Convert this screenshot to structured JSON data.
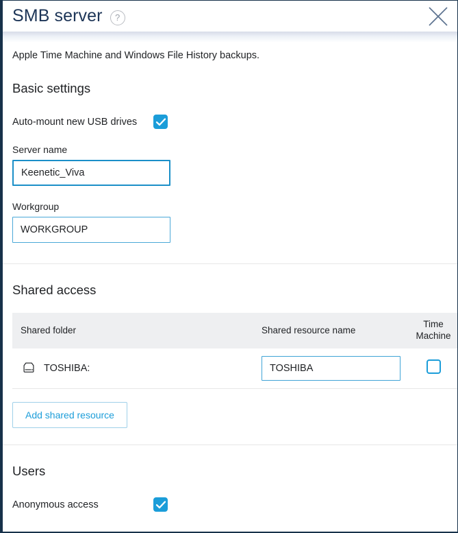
{
  "dialog": {
    "title": "SMB server",
    "help_icon": "?",
    "close_icon": "close-icon"
  },
  "intro": {
    "clipped_line": ".                        .  .",
    "text": "Apple Time Machine and Windows File History backups."
  },
  "basic_settings": {
    "heading": "Basic settings",
    "auto_mount": {
      "label": "Auto-mount new USB drives",
      "checked": "true"
    },
    "server_name": {
      "label": "Server name",
      "value": "Keenetic_Viva",
      "placeholder": "Server name"
    },
    "workgroup": {
      "label": "Workgroup",
      "value": "WORKGROUP",
      "placeholder": "Workgroup"
    }
  },
  "shared_access": {
    "heading": "Shared access",
    "columns": {
      "folder": "Shared folder",
      "resource": "Shared resource name",
      "time_machine_line1": "Time",
      "time_machine_line2": "Machine"
    },
    "rows": [
      {
        "icon": "hard-drive-icon",
        "folder": "TOSHIBA:",
        "resource_value": "TOSHIBA",
        "resource_placeholder": "Shared resource name",
        "time_machine_checked": "false"
      }
    ],
    "add_button": "Add shared resource"
  },
  "users": {
    "heading": "Users",
    "anonymous_access": {
      "label": "Anonymous access",
      "checked": "true"
    }
  },
  "colors": {
    "accent": "#1b9dd9",
    "title": "#1d3557",
    "frame": "#17314a",
    "table_header_bg": "#eeeff1"
  }
}
